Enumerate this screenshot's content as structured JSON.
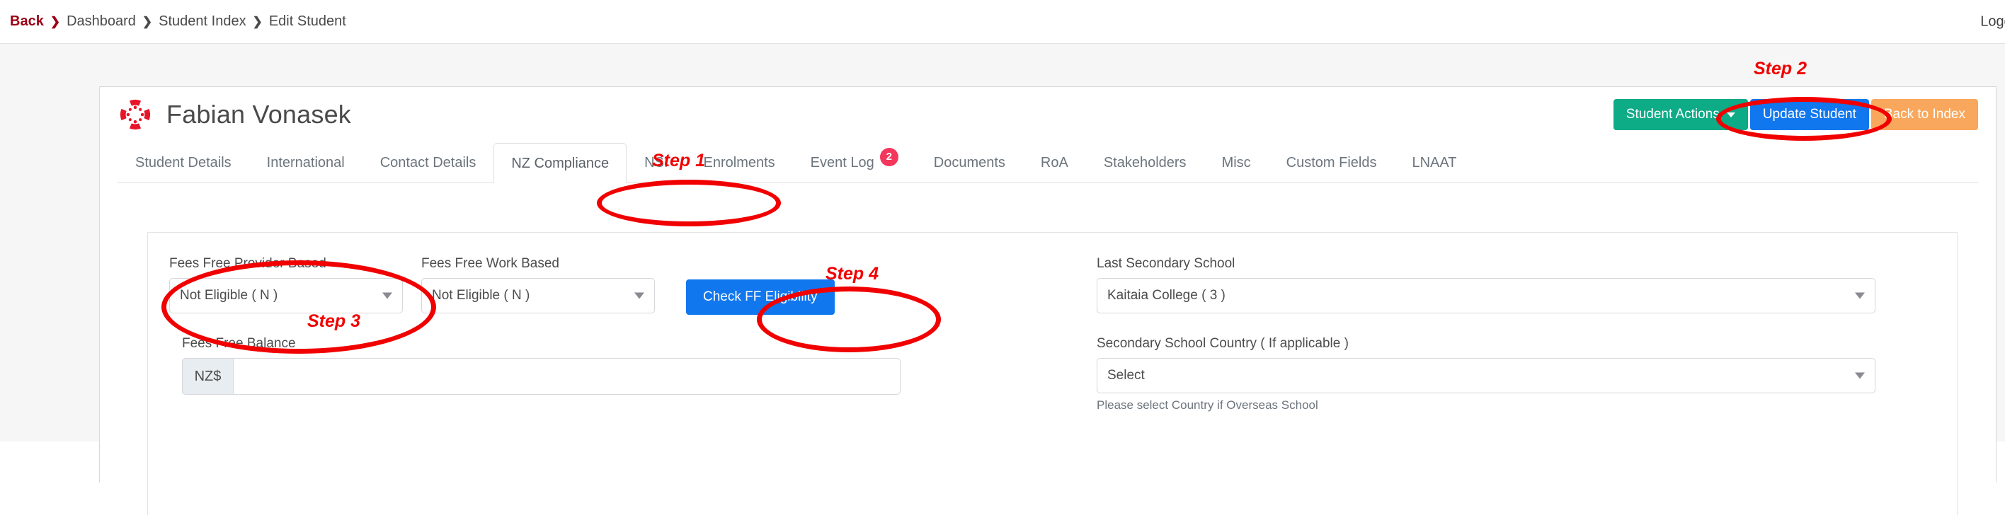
{
  "breadcrumb": {
    "back_label": "Back",
    "separator": "❯",
    "items": [
      {
        "label": "Dashboard"
      },
      {
        "label": "Student Index"
      },
      {
        "label": "Edit Student"
      }
    ],
    "logged_in_text": "Logged"
  },
  "header": {
    "student_name": "Fabian Vonasek",
    "logo_icon": "canvas-logo-icon",
    "actions": {
      "student_actions_label": "Student Actions",
      "update_student_label": "Update Student",
      "back_to_index_label": "Back to Index"
    }
  },
  "tabs": [
    {
      "label": "Student Details",
      "active": false
    },
    {
      "label": "International",
      "active": false
    },
    {
      "label": "Contact Details",
      "active": false
    },
    {
      "label": "NZ Compliance",
      "active": true
    },
    {
      "label": "NSI",
      "active": false
    },
    {
      "label": "Enrolments",
      "active": false
    },
    {
      "label": "Event Log",
      "active": false,
      "badge": "2"
    },
    {
      "label": "Documents",
      "active": false
    },
    {
      "label": "RoA",
      "active": false
    },
    {
      "label": "Stakeholders",
      "active": false
    },
    {
      "label": "Misc",
      "active": false
    },
    {
      "label": "Custom Fields",
      "active": false
    },
    {
      "label": "LNAAT",
      "active": false
    }
  ],
  "form": {
    "fees_free_provider_based": {
      "label": "Fees Free Provider Based",
      "value": "Not Eligible ( N )"
    },
    "fees_free_work_based": {
      "label": "Fees Free Work Based",
      "value": "Not Eligible ( N )"
    },
    "check_eligibility_button": "Check FF Eligibility",
    "fees_free_balance": {
      "label": "Fees Free Balance",
      "currency_addon": "NZ$",
      "value": "",
      "placeholder": ""
    },
    "last_secondary_school": {
      "label": "Last Secondary School",
      "value": "Kaitaia College ( 3 )"
    },
    "secondary_school_country": {
      "label": "Secondary School Country ( If applicable )",
      "value": "Select",
      "help": "Please select Country if Overseas School"
    }
  },
  "annotations": {
    "color": "#f10000",
    "steps": [
      {
        "id": "step-1",
        "label": "Step 1"
      },
      {
        "id": "step-2",
        "label": "Step 2"
      },
      {
        "id": "step-3",
        "label": "Step 3"
      },
      {
        "id": "step-4",
        "label": "Step 4"
      }
    ]
  },
  "colors": {
    "brand_red": "#e8152a",
    "green_button": "#0eab87",
    "blue_button": "#1177ee",
    "orange_button": "#f9a75c",
    "badge_red": "#f5365c",
    "breadcrumb_back": "#9b0014",
    "annotation_red": "#f10000",
    "page_background": "#f6f6f6"
  }
}
